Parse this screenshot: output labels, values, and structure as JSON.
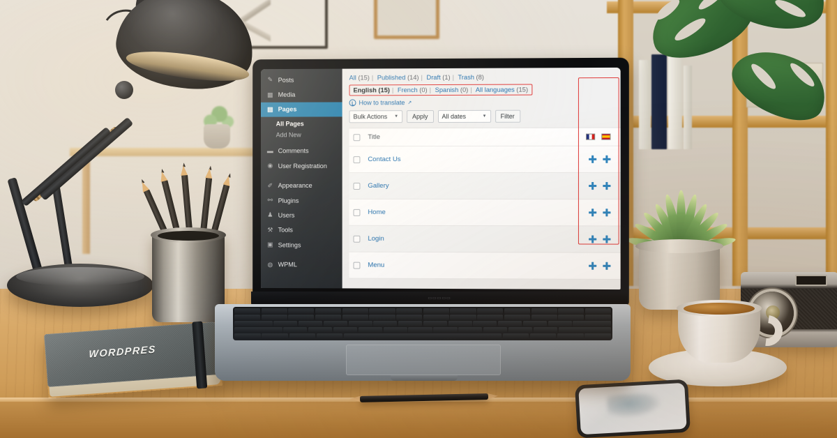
{
  "scene": {
    "description": "Desk workspace with laptop showing WordPress Pages admin with WPML language columns",
    "notebook_label": "WORDPRES"
  },
  "wp_admin": {
    "sidebar": {
      "items": [
        {
          "label": "Posts",
          "icon": "pin-icon",
          "active": false
        },
        {
          "label": "Media",
          "icon": "media-icon",
          "active": false
        },
        {
          "label": "Pages",
          "icon": "page-icon",
          "active": true
        },
        {
          "label": "Comments",
          "icon": "comment-icon",
          "active": false
        },
        {
          "label": "User Registration",
          "icon": "user-registration-icon",
          "active": false
        },
        {
          "label": "Appearance",
          "icon": "brush-icon",
          "active": false
        },
        {
          "label": "Plugins",
          "icon": "plug-icon",
          "active": false
        },
        {
          "label": "Users",
          "icon": "users-icon",
          "active": false
        },
        {
          "label": "Tools",
          "icon": "wrench-icon",
          "active": false
        },
        {
          "label": "Settings",
          "icon": "settings-icon",
          "active": false
        },
        {
          "label": "WPML",
          "icon": "wpml-icon",
          "active": false
        }
      ],
      "submenu": [
        {
          "label": "All Pages",
          "current": true
        },
        {
          "label": "Add New",
          "current": false
        }
      ]
    },
    "status_filters": [
      {
        "label": "All",
        "count": "(15)",
        "current": true
      },
      {
        "label": "Published",
        "count": "(14)",
        "current": false
      },
      {
        "label": "Draft",
        "count": "(1)",
        "current": false
      },
      {
        "label": "Trash",
        "count": "(8)",
        "current": false
      }
    ],
    "language_filters": [
      {
        "label": "English",
        "count": "(15)",
        "current": true
      },
      {
        "label": "French",
        "count": "(0)",
        "current": false
      },
      {
        "label": "Spanish",
        "count": "(0)",
        "current": false
      },
      {
        "label": "All languages",
        "count": "(15)",
        "current": false
      }
    ],
    "how_to_translate": "How to translate",
    "toolbar": {
      "bulk_actions_label": "Bulk Actions",
      "apply_label": "Apply",
      "all_dates_label": "All dates",
      "filter_label": "Filter"
    },
    "table": {
      "title_column": "Title",
      "language_columns": [
        {
          "name": "french-flag",
          "label": "French"
        },
        {
          "name": "spanish-flag",
          "label": "Spanish"
        }
      ],
      "rows": [
        {
          "title": "Contact Us",
          "fr": "add",
          "es": "add"
        },
        {
          "title": "Gallery",
          "fr": "add",
          "es": "add"
        },
        {
          "title": "Home",
          "fr": "add",
          "es": "add"
        },
        {
          "title": "Login",
          "fr": "add",
          "es": "add"
        },
        {
          "title": "Menu",
          "fr": "add",
          "es": "add"
        }
      ]
    },
    "colors": {
      "accent_blue": "#1d7eb0",
      "link_blue": "#2271b1",
      "sidebar_bg": "#23282d",
      "highlight_red": "#e03a3a",
      "plus_blue": "#2e86c1"
    }
  }
}
